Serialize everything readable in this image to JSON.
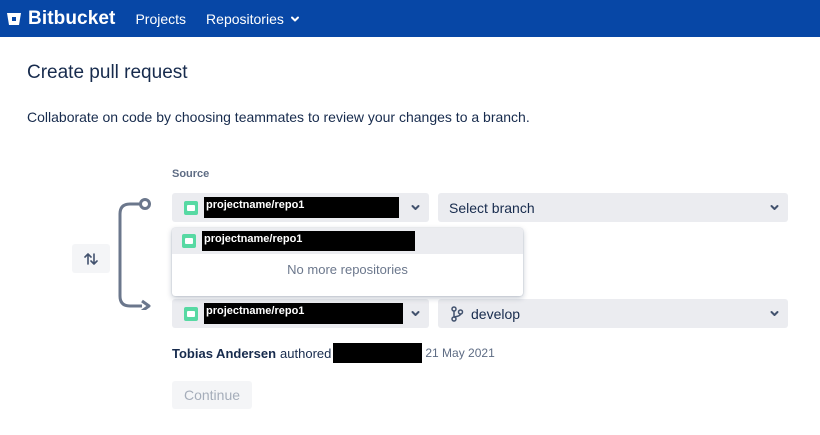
{
  "topbar": {
    "brand": "Bitbucket",
    "nav": [
      {
        "label": "Projects"
      },
      {
        "label": "Repositories",
        "icon": "chevron-down-icon"
      }
    ],
    "color": "#0747a6"
  },
  "page": {
    "title": "Create pull request",
    "description": "Collaborate on code by choosing teammates to review your changes to a branch."
  },
  "source": {
    "label": "Source",
    "repo": "projectname/repo1",
    "branch_placeholder": "Select branch"
  },
  "dropdown": {
    "option": "projectname/repo1",
    "empty_text": "No more repositories"
  },
  "destination": {
    "repo": "projectname/repo1",
    "branch": "develop"
  },
  "author": {
    "name": "Tobias Andersen",
    "verb": "authored",
    "date": "21 May 2021"
  },
  "actions": {
    "continue_label": "Continue"
  },
  "colors": {
    "repo_icon": "#57d9a3",
    "select_bg": "#ebecf0",
    "connector": "#6b778c"
  }
}
